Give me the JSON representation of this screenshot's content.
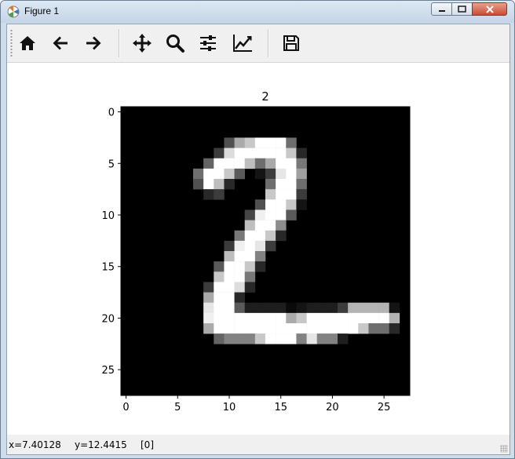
{
  "window": {
    "title": "Figure 1"
  },
  "toolbar": {
    "tools": [
      {
        "name": "home",
        "icon": "home-icon"
      },
      {
        "name": "back",
        "icon": "arrow-left-icon"
      },
      {
        "name": "forward",
        "icon": "arrow-right-icon"
      },
      {
        "name": "pan",
        "icon": "move-icon"
      },
      {
        "name": "zoom",
        "icon": "magnifier-icon"
      },
      {
        "name": "subplots",
        "icon": "sliders-icon"
      },
      {
        "name": "edit-axes",
        "icon": "line-chart-icon"
      },
      {
        "name": "save",
        "icon": "floppy-disk-icon"
      }
    ]
  },
  "status": {
    "x_label": "x=7.40128",
    "y_label": "y=12.4415",
    "value_label": "[0]"
  },
  "chart_data": {
    "type": "heatmap",
    "title": "2",
    "colormap": "gray",
    "rows": 28,
    "cols": 28,
    "xticks": [
      0,
      5,
      10,
      15,
      20,
      25
    ],
    "yticks": [
      0,
      5,
      10,
      15,
      20,
      25
    ],
    "xlim": [
      -0.5,
      27.5
    ],
    "ylim": [
      27.5,
      -0.5
    ],
    "grid": false,
    "pixels": [
      {
        "r": 3,
        "c": 10,
        "v": 80
      },
      {
        "r": 3,
        "c": 11,
        "v": 170
      },
      {
        "r": 3,
        "c": 12,
        "v": 200
      },
      {
        "r": 3,
        "c": 13,
        "v": 255
      },
      {
        "r": 3,
        "c": 14,
        "v": 255
      },
      {
        "r": 3,
        "c": 15,
        "v": 255
      },
      {
        "r": 3,
        "c": 16,
        "v": 110
      },
      {
        "r": 4,
        "c": 9,
        "v": 60
      },
      {
        "r": 4,
        "c": 10,
        "v": 220
      },
      {
        "r": 4,
        "c": 11,
        "v": 255
      },
      {
        "r": 4,
        "c": 12,
        "v": 255
      },
      {
        "r": 4,
        "c": 13,
        "v": 255
      },
      {
        "r": 4,
        "c": 14,
        "v": 255
      },
      {
        "r": 4,
        "c": 15,
        "v": 255
      },
      {
        "r": 4,
        "c": 16,
        "v": 200
      },
      {
        "r": 4,
        "c": 17,
        "v": 40
      },
      {
        "r": 5,
        "c": 8,
        "v": 100
      },
      {
        "r": 5,
        "c": 9,
        "v": 255
      },
      {
        "r": 5,
        "c": 10,
        "v": 255
      },
      {
        "r": 5,
        "c": 11,
        "v": 255
      },
      {
        "r": 5,
        "c": 12,
        "v": 190
      },
      {
        "r": 5,
        "c": 13,
        "v": 110
      },
      {
        "r": 5,
        "c": 14,
        "v": 170
      },
      {
        "r": 5,
        "c": 15,
        "v": 255
      },
      {
        "r": 5,
        "c": 16,
        "v": 255
      },
      {
        "r": 5,
        "c": 17,
        "v": 120
      },
      {
        "r": 6,
        "c": 7,
        "v": 110
      },
      {
        "r": 6,
        "c": 8,
        "v": 255
      },
      {
        "r": 6,
        "c": 9,
        "v": 255
      },
      {
        "r": 6,
        "c": 10,
        "v": 200
      },
      {
        "r": 6,
        "c": 11,
        "v": 90
      },
      {
        "r": 6,
        "c": 13,
        "v": 20
      },
      {
        "r": 6,
        "c": 14,
        "v": 60
      },
      {
        "r": 6,
        "c": 15,
        "v": 230
      },
      {
        "r": 6,
        "c": 16,
        "v": 255
      },
      {
        "r": 6,
        "c": 17,
        "v": 160
      },
      {
        "r": 7,
        "c": 7,
        "v": 80
      },
      {
        "r": 7,
        "c": 8,
        "v": 255
      },
      {
        "r": 7,
        "c": 9,
        "v": 190
      },
      {
        "r": 7,
        "c": 10,
        "v": 40
      },
      {
        "r": 7,
        "c": 14,
        "v": 110
      },
      {
        "r": 7,
        "c": 15,
        "v": 255
      },
      {
        "r": 7,
        "c": 16,
        "v": 255
      },
      {
        "r": 7,
        "c": 17,
        "v": 110
      },
      {
        "r": 8,
        "c": 8,
        "v": 40
      },
      {
        "r": 8,
        "c": 9,
        "v": 60
      },
      {
        "r": 8,
        "c": 14,
        "v": 200
      },
      {
        "r": 8,
        "c": 15,
        "v": 255
      },
      {
        "r": 8,
        "c": 16,
        "v": 255
      },
      {
        "r": 8,
        "c": 17,
        "v": 60
      },
      {
        "r": 9,
        "c": 13,
        "v": 80
      },
      {
        "r": 9,
        "c": 14,
        "v": 255
      },
      {
        "r": 9,
        "c": 15,
        "v": 255
      },
      {
        "r": 9,
        "c": 16,
        "v": 200
      },
      {
        "r": 9,
        "c": 17,
        "v": 20
      },
      {
        "r": 10,
        "c": 12,
        "v": 70
      },
      {
        "r": 10,
        "c": 13,
        "v": 240
      },
      {
        "r": 10,
        "c": 14,
        "v": 255
      },
      {
        "r": 10,
        "c": 15,
        "v": 255
      },
      {
        "r": 10,
        "c": 16,
        "v": 90
      },
      {
        "r": 11,
        "c": 12,
        "v": 190
      },
      {
        "r": 11,
        "c": 13,
        "v": 255
      },
      {
        "r": 11,
        "c": 14,
        "v": 255
      },
      {
        "r": 11,
        "c": 15,
        "v": 140
      },
      {
        "r": 12,
        "c": 11,
        "v": 120
      },
      {
        "r": 12,
        "c": 12,
        "v": 255
      },
      {
        "r": 12,
        "c": 13,
        "v": 255
      },
      {
        "r": 12,
        "c": 14,
        "v": 200
      },
      {
        "r": 12,
        "c": 15,
        "v": 40
      },
      {
        "r": 13,
        "c": 10,
        "v": 60
      },
      {
        "r": 13,
        "c": 11,
        "v": 240
      },
      {
        "r": 13,
        "c": 12,
        "v": 255
      },
      {
        "r": 13,
        "c": 13,
        "v": 230
      },
      {
        "r": 13,
        "c": 14,
        "v": 60
      },
      {
        "r": 14,
        "c": 10,
        "v": 190
      },
      {
        "r": 14,
        "c": 11,
        "v": 255
      },
      {
        "r": 14,
        "c": 12,
        "v": 255
      },
      {
        "r": 14,
        "c": 13,
        "v": 130
      },
      {
        "r": 15,
        "c": 9,
        "v": 90
      },
      {
        "r": 15,
        "c": 10,
        "v": 255
      },
      {
        "r": 15,
        "c": 11,
        "v": 255
      },
      {
        "r": 15,
        "c": 12,
        "v": 200
      },
      {
        "r": 15,
        "c": 13,
        "v": 40
      },
      {
        "r": 16,
        "c": 9,
        "v": 200
      },
      {
        "r": 16,
        "c": 10,
        "v": 255
      },
      {
        "r": 16,
        "c": 11,
        "v": 255
      },
      {
        "r": 16,
        "c": 12,
        "v": 120
      },
      {
        "r": 17,
        "c": 8,
        "v": 60
      },
      {
        "r": 17,
        "c": 9,
        "v": 255
      },
      {
        "r": 17,
        "c": 10,
        "v": 255
      },
      {
        "r": 17,
        "c": 11,
        "v": 220
      },
      {
        "r": 17,
        "c": 12,
        "v": 40
      },
      {
        "r": 18,
        "c": 8,
        "v": 170
      },
      {
        "r": 18,
        "c": 9,
        "v": 255
      },
      {
        "r": 18,
        "c": 10,
        "v": 255
      },
      {
        "r": 18,
        "c": 11,
        "v": 40
      },
      {
        "r": 19,
        "c": 8,
        "v": 230
      },
      {
        "r": 19,
        "c": 9,
        "v": 255
      },
      {
        "r": 19,
        "c": 10,
        "v": 255
      },
      {
        "r": 19,
        "c": 11,
        "v": 90
      },
      {
        "r": 19,
        "c": 12,
        "v": 30
      },
      {
        "r": 19,
        "c": 13,
        "v": 30
      },
      {
        "r": 19,
        "c": 14,
        "v": 30
      },
      {
        "r": 19,
        "c": 15,
        "v": 30
      },
      {
        "r": 19,
        "c": 16,
        "v": 10
      },
      {
        "r": 19,
        "c": 17,
        "v": 20
      },
      {
        "r": 19,
        "c": 18,
        "v": 30
      },
      {
        "r": 19,
        "c": 19,
        "v": 30
      },
      {
        "r": 19,
        "c": 20,
        "v": 30
      },
      {
        "r": 19,
        "c": 21,
        "v": 60
      },
      {
        "r": 19,
        "c": 22,
        "v": 180
      },
      {
        "r": 19,
        "c": 23,
        "v": 180
      },
      {
        "r": 19,
        "c": 24,
        "v": 180
      },
      {
        "r": 19,
        "c": 25,
        "v": 180
      },
      {
        "r": 19,
        "c": 26,
        "v": 20
      },
      {
        "r": 20,
        "c": 8,
        "v": 240
      },
      {
        "r": 20,
        "c": 9,
        "v": 255
      },
      {
        "r": 20,
        "c": 10,
        "v": 255
      },
      {
        "r": 20,
        "c": 11,
        "v": 255
      },
      {
        "r": 20,
        "c": 12,
        "v": 255
      },
      {
        "r": 20,
        "c": 13,
        "v": 255
      },
      {
        "r": 20,
        "c": 14,
        "v": 255
      },
      {
        "r": 20,
        "c": 15,
        "v": 255
      },
      {
        "r": 20,
        "c": 16,
        "v": 170
      },
      {
        "r": 20,
        "c": 17,
        "v": 200
      },
      {
        "r": 20,
        "c": 18,
        "v": 255
      },
      {
        "r": 20,
        "c": 19,
        "v": 255
      },
      {
        "r": 20,
        "c": 20,
        "v": 255
      },
      {
        "r": 20,
        "c": 21,
        "v": 255
      },
      {
        "r": 20,
        "c": 22,
        "v": 255
      },
      {
        "r": 20,
        "c": 23,
        "v": 255
      },
      {
        "r": 20,
        "c": 24,
        "v": 255
      },
      {
        "r": 20,
        "c": 25,
        "v": 255
      },
      {
        "r": 20,
        "c": 26,
        "v": 180
      },
      {
        "r": 21,
        "c": 8,
        "v": 170
      },
      {
        "r": 21,
        "c": 9,
        "v": 255
      },
      {
        "r": 21,
        "c": 10,
        "v": 255
      },
      {
        "r": 21,
        "c": 11,
        "v": 255
      },
      {
        "r": 21,
        "c": 12,
        "v": 255
      },
      {
        "r": 21,
        "c": 13,
        "v": 255
      },
      {
        "r": 21,
        "c": 14,
        "v": 255
      },
      {
        "r": 21,
        "c": 15,
        "v": 255
      },
      {
        "r": 21,
        "c": 16,
        "v": 255
      },
      {
        "r": 21,
        "c": 17,
        "v": 255
      },
      {
        "r": 21,
        "c": 18,
        "v": 255
      },
      {
        "r": 21,
        "c": 19,
        "v": 255
      },
      {
        "r": 21,
        "c": 20,
        "v": 255
      },
      {
        "r": 21,
        "c": 21,
        "v": 255
      },
      {
        "r": 21,
        "c": 22,
        "v": 255
      },
      {
        "r": 21,
        "c": 23,
        "v": 200
      },
      {
        "r": 21,
        "c": 24,
        "v": 110
      },
      {
        "r": 21,
        "c": 25,
        "v": 110
      },
      {
        "r": 21,
        "c": 26,
        "v": 40
      },
      {
        "r": 22,
        "c": 9,
        "v": 100
      },
      {
        "r": 22,
        "c": 10,
        "v": 130
      },
      {
        "r": 22,
        "c": 11,
        "v": 130
      },
      {
        "r": 22,
        "c": 12,
        "v": 130
      },
      {
        "r": 22,
        "c": 13,
        "v": 200
      },
      {
        "r": 22,
        "c": 14,
        "v": 255
      },
      {
        "r": 22,
        "c": 15,
        "v": 255
      },
      {
        "r": 22,
        "c": 16,
        "v": 255
      },
      {
        "r": 22,
        "c": 17,
        "v": 130
      },
      {
        "r": 22,
        "c": 18,
        "v": 230
      },
      {
        "r": 22,
        "c": 19,
        "v": 130
      },
      {
        "r": 22,
        "c": 20,
        "v": 130
      },
      {
        "r": 22,
        "c": 21,
        "v": 30
      }
    ]
  }
}
